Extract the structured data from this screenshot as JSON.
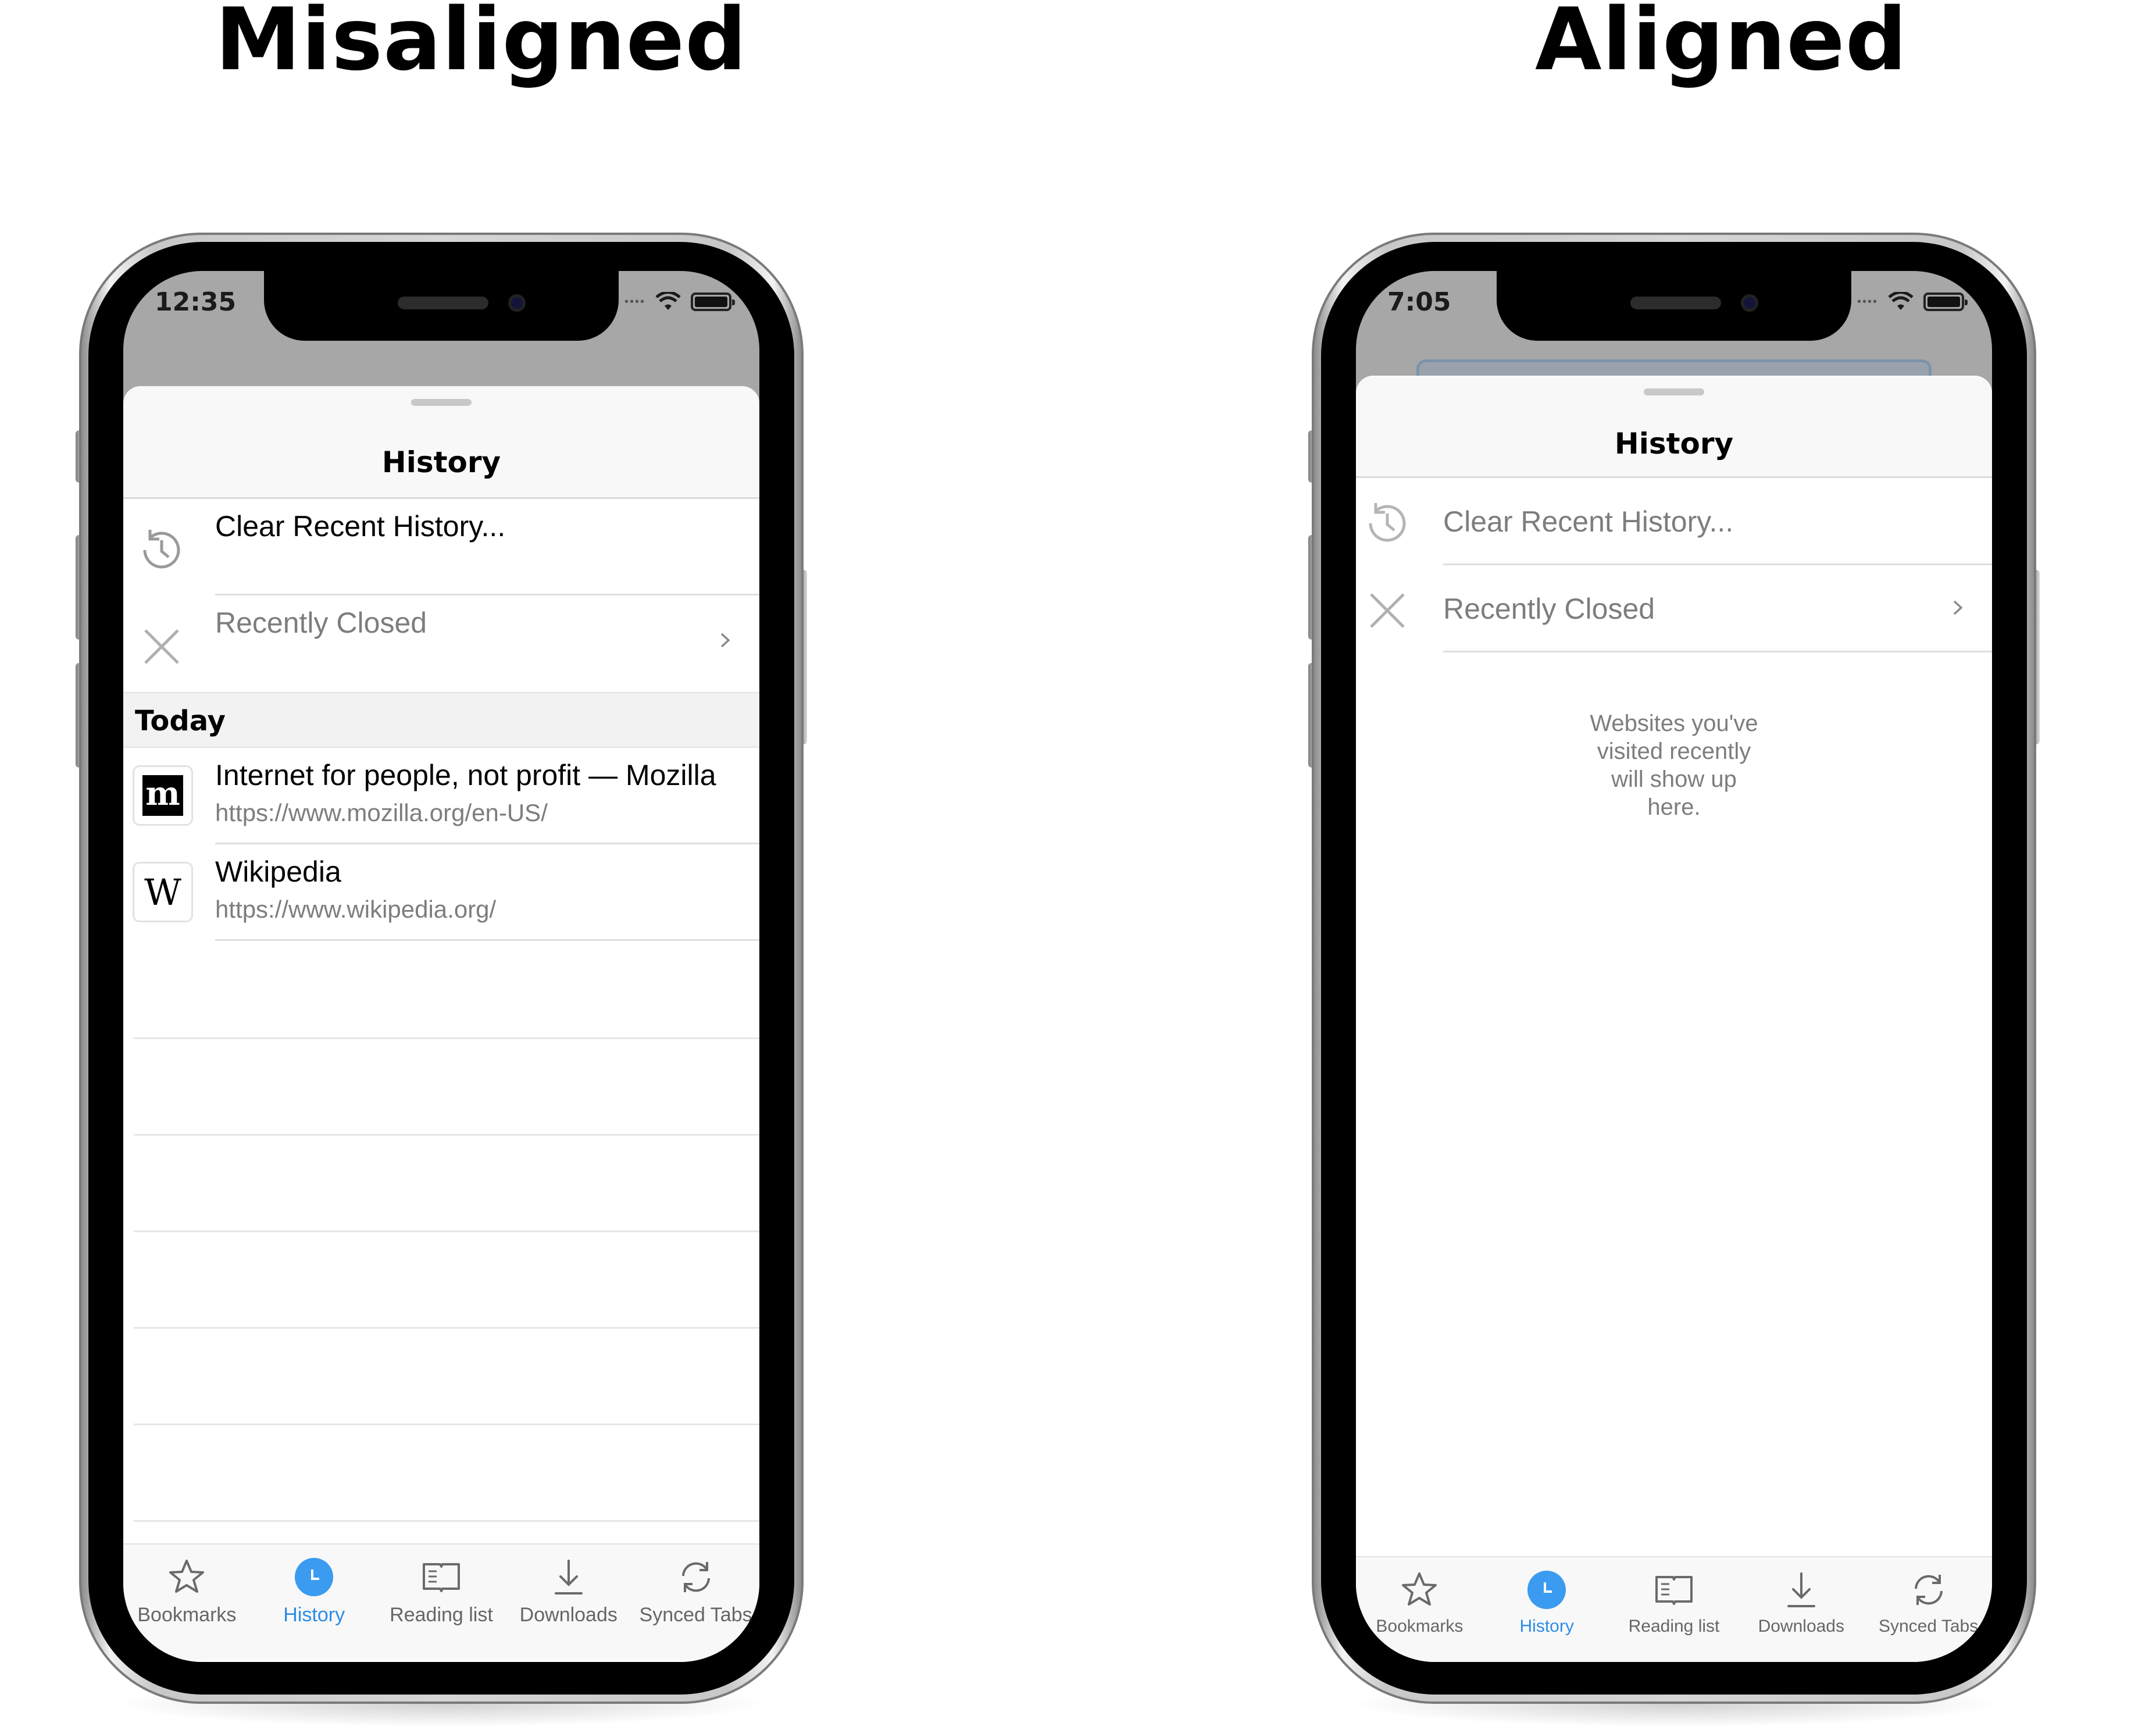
{
  "headings": {
    "left": "Misaligned",
    "right": "Aligned"
  },
  "accent_color": "#2c8ce8",
  "left_phone": {
    "status_time": "12:35",
    "title": "History",
    "rows": [
      {
        "label": "Clear Recent History...",
        "icon": "clock-history-icon"
      },
      {
        "label": "Recently Closed",
        "icon": "close-icon",
        "chevron": true
      }
    ],
    "section": "Today",
    "sites": [
      {
        "title": "Internet for people, not profit — Mozilla",
        "url": "https://www.mozilla.org/en-US/",
        "favicon": "m"
      },
      {
        "title": "Wikipedia",
        "url": "https://www.wikipedia.org/",
        "favicon": "W"
      }
    ]
  },
  "right_phone": {
    "status_time": "7:05",
    "title": "History",
    "rows": [
      {
        "label": "Clear Recent History...",
        "icon": "clock-history-icon"
      },
      {
        "label": "Recently Closed",
        "icon": "close-icon",
        "chevron": true
      }
    ],
    "empty_message": "Websites you've visited recently will show up here."
  },
  "tabs": [
    {
      "label": "Bookmarks",
      "icon": "star-icon"
    },
    {
      "label": "History",
      "icon": "history-icon",
      "active": true
    },
    {
      "label": "Reading list",
      "icon": "book-icon"
    },
    {
      "label": "Downloads",
      "icon": "download-icon"
    },
    {
      "label": "Synced Tabs",
      "icon": "sync-icon"
    }
  ]
}
